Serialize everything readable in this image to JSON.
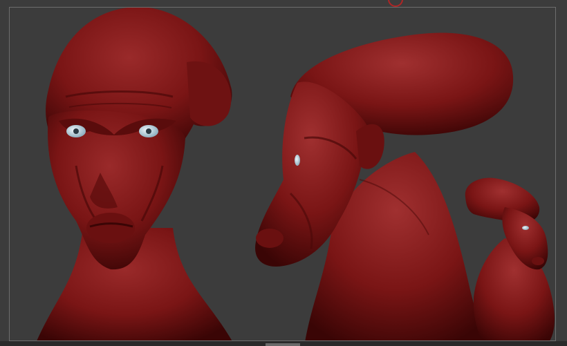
{
  "viewport": {
    "background": "#3c3c3c",
    "frame_color": "#6e6e6e"
  },
  "model": {
    "material_color": "#7a1515",
    "highlight_color": "#9a2a2a",
    "shadow_color": "#3a0505",
    "eye_color": "#c8dde8",
    "views": [
      "front-view",
      "side-view",
      "three-quarter-view"
    ]
  },
  "icons": {
    "top_indicator": "ring-icon",
    "bottom_indicator": "scroll-handle-icon"
  }
}
